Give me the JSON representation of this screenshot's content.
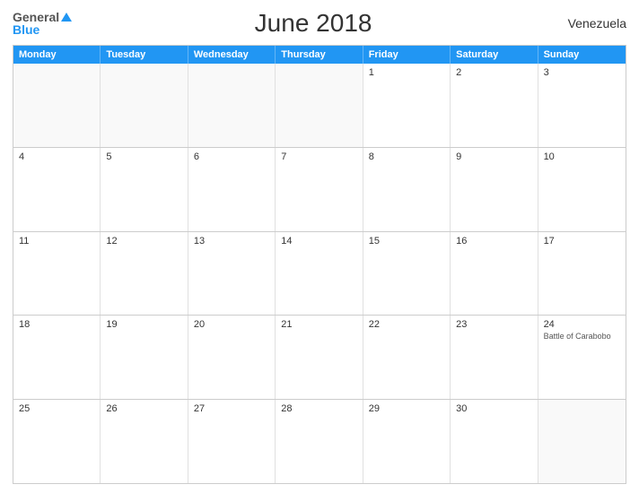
{
  "logo": {
    "general": "General",
    "blue": "Blue"
  },
  "title": "June 2018",
  "country": "Venezuela",
  "header": {
    "days": [
      "Monday",
      "Tuesday",
      "Wednesday",
      "Thursday",
      "Friday",
      "Saturday",
      "Sunday"
    ]
  },
  "weeks": [
    [
      {
        "day": "",
        "event": ""
      },
      {
        "day": "",
        "event": ""
      },
      {
        "day": "",
        "event": ""
      },
      {
        "day": "",
        "event": ""
      },
      {
        "day": "1",
        "event": ""
      },
      {
        "day": "2",
        "event": ""
      },
      {
        "day": "3",
        "event": ""
      }
    ],
    [
      {
        "day": "4",
        "event": ""
      },
      {
        "day": "5",
        "event": ""
      },
      {
        "day": "6",
        "event": ""
      },
      {
        "day": "7",
        "event": ""
      },
      {
        "day": "8",
        "event": ""
      },
      {
        "day": "9",
        "event": ""
      },
      {
        "day": "10",
        "event": ""
      }
    ],
    [
      {
        "day": "11",
        "event": ""
      },
      {
        "day": "12",
        "event": ""
      },
      {
        "day": "13",
        "event": ""
      },
      {
        "day": "14",
        "event": ""
      },
      {
        "day": "15",
        "event": ""
      },
      {
        "day": "16",
        "event": ""
      },
      {
        "day": "17",
        "event": ""
      }
    ],
    [
      {
        "day": "18",
        "event": ""
      },
      {
        "day": "19",
        "event": ""
      },
      {
        "day": "20",
        "event": ""
      },
      {
        "day": "21",
        "event": ""
      },
      {
        "day": "22",
        "event": ""
      },
      {
        "day": "23",
        "event": ""
      },
      {
        "day": "24",
        "event": "Battle of Carabobo"
      }
    ],
    [
      {
        "day": "25",
        "event": ""
      },
      {
        "day": "26",
        "event": ""
      },
      {
        "day": "27",
        "event": ""
      },
      {
        "day": "28",
        "event": ""
      },
      {
        "day": "29",
        "event": ""
      },
      {
        "day": "30",
        "event": ""
      },
      {
        "day": "",
        "event": ""
      }
    ]
  ]
}
